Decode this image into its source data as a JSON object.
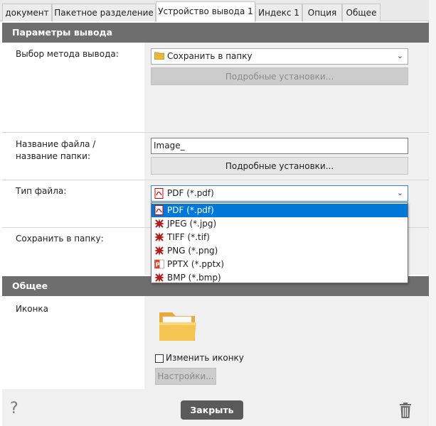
{
  "tabs": [
    {
      "label": "документ",
      "active": false
    },
    {
      "label": "Пакетное разделение",
      "active": false
    },
    {
      "label": "Устройство вывода 1",
      "active": true
    },
    {
      "label": "Индекс 1",
      "active": false
    },
    {
      "label": "Опция",
      "active": false
    },
    {
      "label": "Общее",
      "active": false
    }
  ],
  "output_section": {
    "title": "Параметры вывода",
    "method": {
      "label": "Выбор метода вывода:",
      "value": "Сохранить в папку",
      "details_button": "Подробные установки..."
    },
    "filename": {
      "label": "Название файла / название папки:",
      "value": "Image_",
      "details_button": "Подробные установки..."
    },
    "filetype": {
      "label": "Тип файла:",
      "value": "PDF (*.pdf)",
      "options": [
        {
          "label": "PDF (*.pdf)",
          "icon": "pdf-icon",
          "selected": true
        },
        {
          "label": "JPEG (*.jpg)",
          "icon": "jpeg-icon",
          "selected": false
        },
        {
          "label": "TIFF (*.tif)",
          "icon": "tiff-icon",
          "selected": false
        },
        {
          "label": "PNG (*.png)",
          "icon": "png-icon",
          "selected": false
        },
        {
          "label": "PPTX (*.pptx)",
          "icon": "pptx-icon",
          "selected": false
        },
        {
          "label": "BMP (*.bmp)",
          "icon": "bmp-icon",
          "selected": false
        }
      ]
    },
    "save_to": {
      "label": "Сохранить в папку:"
    }
  },
  "general_section": {
    "title": "Общее",
    "icon_label": "Иконка",
    "change_icon_label": "Изменить иконку",
    "change_icon_checked": false,
    "settings_button": "Настройки..."
  },
  "footer": {
    "help_glyph": "?",
    "close_button": "Закрыть"
  },
  "colors": {
    "section_header": "#6e6e6e",
    "selection": "#0078d7",
    "close_button": "#5a5a5a"
  }
}
